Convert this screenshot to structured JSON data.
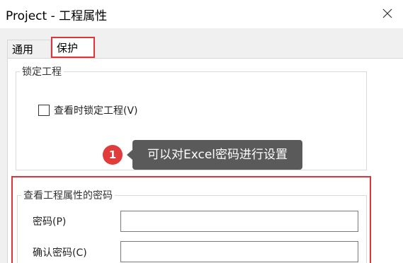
{
  "window": {
    "title": "Project - 工程属性",
    "close_icon": "close-icon"
  },
  "tabs": [
    {
      "label": "通用",
      "selected": false
    },
    {
      "label": "保护",
      "selected": true
    }
  ],
  "lock_group": {
    "legend": "锁定工程",
    "checkbox_label": "查看时锁定工程(V)",
    "checked": false
  },
  "callout": {
    "number": "1",
    "text": "可以对Excel密码进行设置"
  },
  "password_group": {
    "legend": "查看工程属性的密码",
    "password_label": "密码(P)",
    "password_value": "",
    "confirm_label": "确认密码(C)",
    "confirm_value": ""
  },
  "colors": {
    "highlight": "#e0343a",
    "callout_badge": "#e23b3b",
    "callout_bg": "#5a5a5a",
    "dialog_bg": "#f0f0f0"
  }
}
